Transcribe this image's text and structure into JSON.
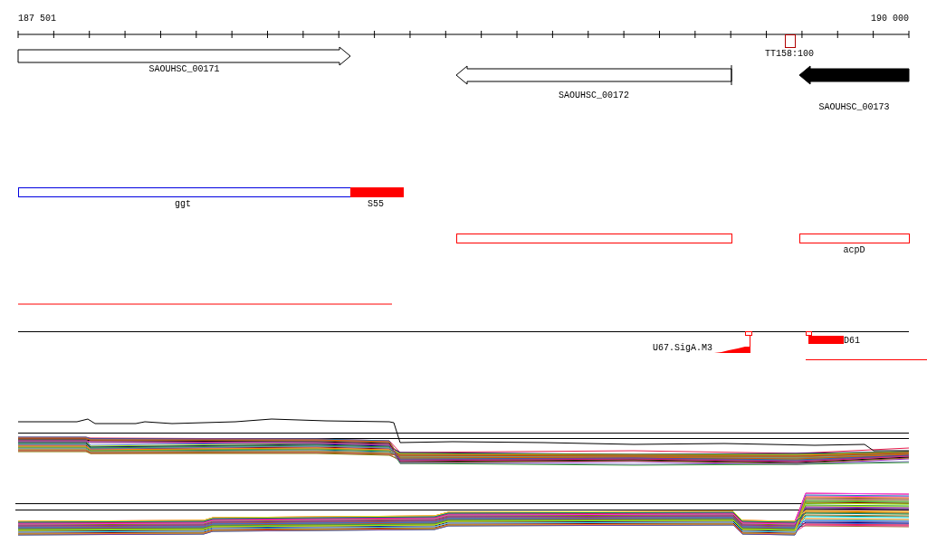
{
  "ruler": {
    "start": "187 501",
    "end": "190 000"
  },
  "terminators": [
    {
      "label": "TT158:100"
    }
  ],
  "genes": [
    {
      "label": "SAOUHSC_00171",
      "kind": "forward",
      "filled": false
    },
    {
      "label": "SAOUHSC_00172",
      "kind": "reverse",
      "filled": false
    },
    {
      "label": "SAOUHSC_00173",
      "kind": "reverse",
      "filled": true
    }
  ],
  "transcript_track": [
    {
      "kind": "gene",
      "label": "ggt"
    },
    {
      "kind": "utr",
      "label": "S55"
    }
  ],
  "regions": [
    {
      "kind": "region"
    },
    {
      "kind": "region",
      "label": "acpD"
    }
  ],
  "promoters": [
    {
      "kind": "ramp",
      "label": "U67.SigA.M3"
    },
    {
      "kind": "block",
      "label": "D61"
    }
  ]
}
